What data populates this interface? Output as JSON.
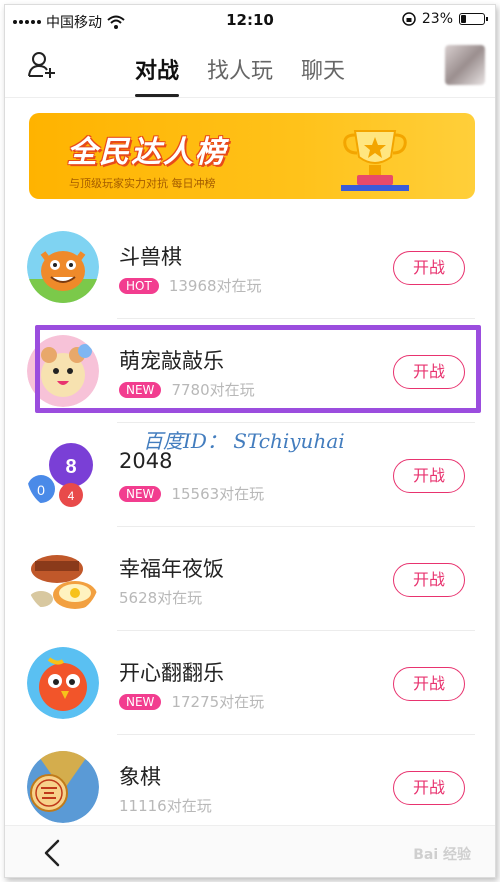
{
  "status_bar": {
    "carrier": "中国移动",
    "time": "12:10",
    "battery_percent": "23%",
    "battery_level": 0.23
  },
  "nav": {
    "tabs": [
      {
        "label": "对战",
        "active": true
      },
      {
        "label": "找人玩",
        "active": false
      },
      {
        "label": "聊天",
        "active": false
      }
    ]
  },
  "banner": {
    "title": "全民达人榜",
    "subtitle": "与顶级玩家实力对抗 每日冲榜"
  },
  "games": [
    {
      "name": "斗兽棋",
      "badge": "HOT",
      "players": "13968对在玩",
      "button": "开战",
      "icon": "monster-icon"
    },
    {
      "name": "萌宠敲敲乐",
      "badge": "NEW",
      "players": "7780对在玩",
      "button": "开战",
      "icon": "hamster-icon"
    },
    {
      "name": "2048",
      "badge": "NEW",
      "players": "15563对在玩",
      "button": "开战",
      "icon": "number-balls-icon"
    },
    {
      "name": "幸福年夜饭",
      "badge": "",
      "players": "5628对在玩",
      "button": "开战",
      "icon": "dinner-icon"
    },
    {
      "name": "开心翻翻乐",
      "badge": "NEW",
      "players": "17275对在玩",
      "button": "开战",
      "icon": "bird-icon"
    },
    {
      "name": "象棋",
      "badge": "",
      "players": "11116对在玩",
      "button": "开战",
      "icon": "chess-icon"
    }
  ],
  "watermark": "百度ID： STchiyuhai",
  "footer": {
    "logo": "Bai 经验"
  },
  "colors": {
    "accent": "#e8336f",
    "badge": "#f23d8f",
    "highlight": "#9b4dde",
    "banner": "#ffc21a"
  }
}
